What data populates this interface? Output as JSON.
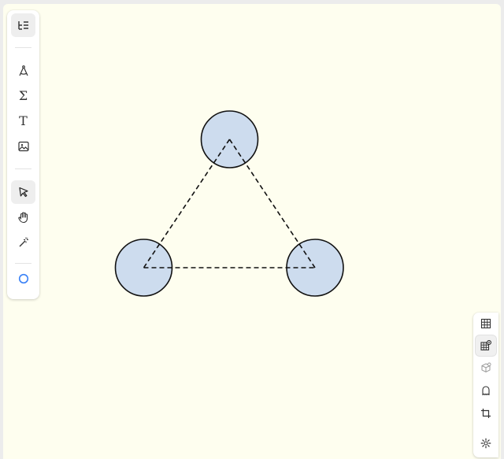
{
  "app": {
    "canvas_background": "#fefeef",
    "accent": "#3b82f6"
  },
  "toolbar": {
    "tools": [
      {
        "id": "outline",
        "icon": "outline-list-icon",
        "active": true
      },
      {
        "id": "compass",
        "icon": "compass-icon",
        "active": false
      },
      {
        "id": "formula",
        "icon": "sigma-icon",
        "label": "Σ",
        "active": false
      },
      {
        "id": "text",
        "icon": "text-icon",
        "label": "T",
        "active": false
      },
      {
        "id": "image",
        "icon": "image-icon",
        "active": false
      },
      {
        "id": "select",
        "icon": "pointer-icon",
        "active": true
      },
      {
        "id": "pan",
        "icon": "hand-icon",
        "active": false
      },
      {
        "id": "magic",
        "icon": "magic-wand-icon",
        "active": false
      },
      {
        "id": "shape",
        "icon": "circle-icon",
        "active": false,
        "color": "#3b82f6"
      }
    ]
  },
  "right_panel": {
    "tools": [
      {
        "id": "grid",
        "icon": "grid-icon",
        "active": false
      },
      {
        "id": "grid-snap",
        "icon": "grid-snap-icon",
        "active": true
      },
      {
        "id": "3d",
        "icon": "cube-icon",
        "active": false
      },
      {
        "id": "ghost",
        "icon": "ghost-icon",
        "active": false
      },
      {
        "id": "crop",
        "icon": "crop-icon",
        "active": false
      },
      {
        "id": "settings",
        "icon": "gear-icon",
        "active": false
      }
    ]
  },
  "drawing": {
    "circle_fill": "#cddcee",
    "circle_stroke": "#111111",
    "line_style": "dashed"
  }
}
